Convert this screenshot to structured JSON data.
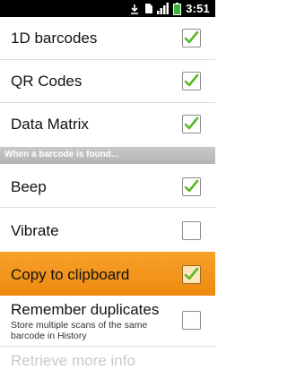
{
  "status_bar": {
    "time": "3:51"
  },
  "rows": [
    {
      "label": "1D barcodes",
      "checked": true
    },
    {
      "label": "QR Codes",
      "checked": true
    },
    {
      "label": "Data Matrix",
      "checked": true
    }
  ],
  "section_header": "When a barcode is found...",
  "rows2": [
    {
      "label": "Beep",
      "checked": true
    },
    {
      "label": "Vibrate",
      "checked": false
    },
    {
      "label": "Copy to clipboard",
      "checked": true,
      "highlighted": true
    },
    {
      "label": "Remember duplicates",
      "summary": "Store multiple scans of the same barcode in History",
      "checked": false
    }
  ],
  "partial_row_label": "Retrieve more info",
  "colors": {
    "highlight": "#f39a1f",
    "check": "#5ab82a"
  }
}
